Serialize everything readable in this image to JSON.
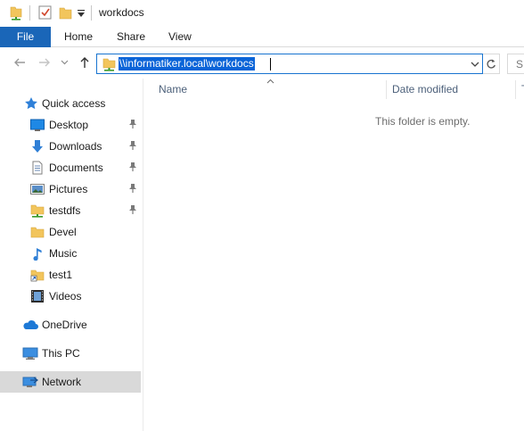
{
  "window": {
    "title": "workdocs"
  },
  "quick_access_toolbar": {
    "icons": [
      "network-folder-icon",
      "properties-checkbox-icon",
      "new-folder-icon",
      "customize-dropdown-icon"
    ]
  },
  "ribbon": {
    "tabs": [
      "File",
      "Home",
      "Share",
      "View"
    ]
  },
  "navigation": {
    "address": "\\\\informatiker.local\\workdocs",
    "search_placeholder": "S"
  },
  "sidebar": {
    "quick_access_label": "Quick access",
    "pinned": [
      {
        "label": "Desktop",
        "icon": "desktop-icon",
        "pinned": true
      },
      {
        "label": "Downloads",
        "icon": "downloads-icon",
        "pinned": true
      },
      {
        "label": "Documents",
        "icon": "documents-icon",
        "pinned": true
      },
      {
        "label": "Pictures",
        "icon": "pictures-icon",
        "pinned": true
      },
      {
        "label": "testdfs",
        "icon": "network-folder-icon",
        "pinned": true
      },
      {
        "label": "Devel",
        "icon": "folder-icon",
        "pinned": false
      },
      {
        "label": "Music",
        "icon": "music-icon",
        "pinned": false
      },
      {
        "label": "test1",
        "icon": "shortcut-folder-icon",
        "pinned": false
      },
      {
        "label": "Videos",
        "icon": "videos-icon",
        "pinned": false
      }
    ],
    "onedrive_label": "OneDrive",
    "thispc_label": "This PC",
    "network_label": "Network"
  },
  "content": {
    "columns": [
      "Name",
      "Date modified",
      "T"
    ],
    "empty_message": "This folder is empty."
  },
  "colors": {
    "file_tab": "#1a66b8",
    "selection": "#0a64d8",
    "address_border": "#1874d0",
    "nav_selected": "#d9d9d9"
  }
}
